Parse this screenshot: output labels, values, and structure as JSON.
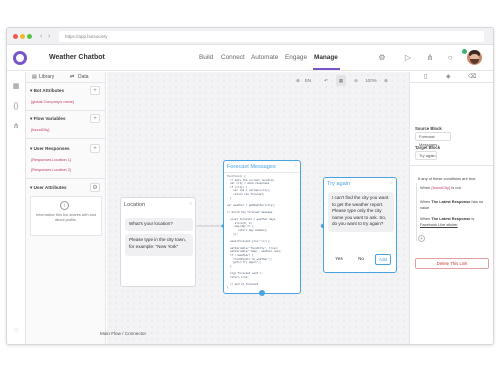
{
  "browser": {
    "url": "https://app.botsociety"
  },
  "app": {
    "title": "Weather Chatbot"
  },
  "nav": {
    "tabs": [
      "Build",
      "Connect",
      "Automate",
      "Engage",
      "Manage"
    ],
    "active": "Manage"
  },
  "left_panel": {
    "tabs": [
      "Library",
      "Data"
    ],
    "bot_attributes": {
      "title": "Bot Attributes",
      "items": [
        "{global.Company's name}"
      ]
    },
    "flow_variables": {
      "title": "Flow Variables",
      "items": [
        "{foundCity}"
      ]
    },
    "user_responses": {
      "title": "User Responses",
      "items": [
        "{Responses.Location 1}",
        "{Responses.Location 2}"
      ]
    },
    "user_attributes": {
      "title": "User Attributes",
      "info": "Information this bot shares with and about profile."
    }
  },
  "canvas": {
    "toolbar": {
      "language": "EN",
      "zoom": "100%"
    },
    "location_node": {
      "title": "Location",
      "message": "What's your location?",
      "followup": "Please type in the city town, for example: \"New York\""
    },
    "forecast_node": {
      "title": "Forecast Messages",
      "code": [
        "function() {",
        "  // Gets the current location",
        "  var city = data.responses",
        "  if (city) {",
        "    var res = callApi(city);",
        "    return res.forecast;",
        "  }",
        "",
        "var weather = getWeather(city);",
        "",
        "// build the forecast message",
        "",
        "  const forecast = weather.days",
        "    .slice(0, 3)",
        "    .map(day => {",
        "       return day.summary;",
        "    });",
        "",
        "  send(forecast.join('\\n'));",
        "",
        "  setVariable('foundCity', true);",
        "  setVariable('temp', weather.now);",
        "  if (!weather) {",
        "    trackEvent('no_weather');",
        "    goTo('Try again');",
        "  }",
        "",
        "  log('forecast sent');",
        "  return true;",
        "",
        "  // end of forecast",
        "}",
        "",
        "  // Build weather forecast message",
        "}"
      ]
    },
    "try_again_node": {
      "title": "Try again",
      "message": "I can't find the city you want to get the weather report. Please type only the city name you want to ask. So, do you want to try again?",
      "buttons": [
        "Yes",
        "No",
        "Add"
      ]
    }
  },
  "right_panel": {
    "source_block_label": "Source Block",
    "source_block_value": "Forecast Messages",
    "target_block_label": "Target Block",
    "target_block_value": "Try again",
    "conditions_title": "If any of these conditions are true",
    "cond1_prefix": "When",
    "cond1_tag": "{foundCity}",
    "cond1_suffix": "is not",
    "cond2_prefix": "When",
    "cond2_bold": "The Latest Response",
    "cond2_suffix": "has no",
    "cond2_value": "value",
    "cond3_prefix": "When",
    "cond3_bold": "The Latest Response",
    "cond3_suffix": "is",
    "cond3_value": "Facebook Like sticker",
    "delete_label": "Delete This Link"
  },
  "breadcrumbs": {
    "items": [
      "Main Flow",
      "Connector"
    ]
  },
  "colors": {
    "accent": "#7a55c9",
    "node_border_active": "#4aa3df",
    "pink": "#c0396b"
  }
}
